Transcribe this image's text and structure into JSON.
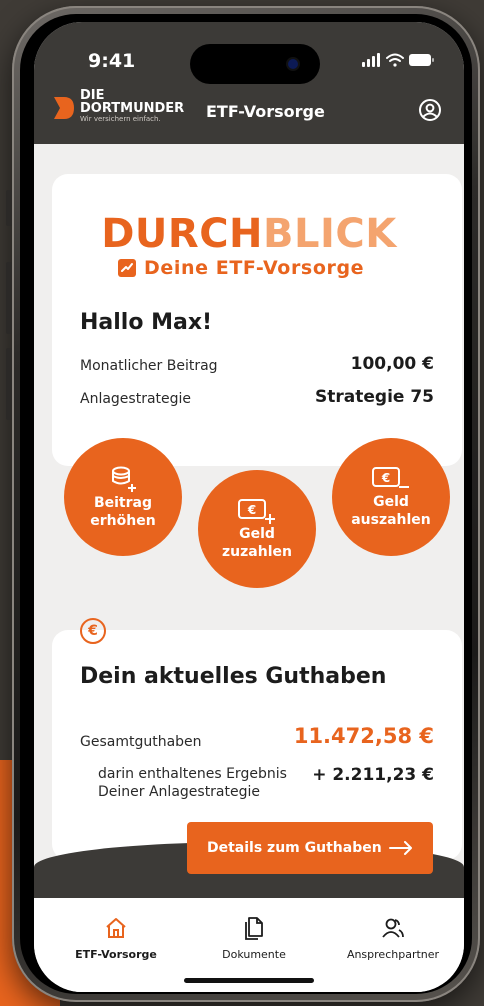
{
  "status": {
    "time": "9:41"
  },
  "header": {
    "logo_line1": "DIE",
    "logo_line2": "DORTMUNDER",
    "logo_tagline": "Wir versichern einfach.",
    "title": "ETF-Vorsorge"
  },
  "brand": {
    "word_dark": "DURCH",
    "word_light": "BLICK",
    "tagline": "Deine ETF-Vorsorge"
  },
  "summary": {
    "greeting": "Hallo Max!",
    "rows": [
      {
        "label": "Monatlicher Beitrag",
        "value": "100,00 €"
      },
      {
        "label": "Anlagestrategie",
        "value": "Strategie 75"
      }
    ]
  },
  "actions": [
    {
      "label": "Beitrag\nerhöhen",
      "icon": "coins-plus-icon"
    },
    {
      "label": "Geld\nzuzahlen",
      "icon": "wallet-plus-icon"
    },
    {
      "label": "Geld\nauszahlen",
      "icon": "wallet-minus-icon"
    }
  ],
  "balance": {
    "badge": "€",
    "title": "Dein aktuelles Guthaben",
    "total_label": "Gesamtguthaben",
    "total_value": "11.472,58 €",
    "result_label": "darin enthaltenes Ergebnis\nDeiner Anlagestrategie",
    "result_value": "+ 2.211,23 €",
    "details_button": "Details zum Guthaben"
  },
  "tabs": [
    {
      "label": "ETF-Vorsorge",
      "icon": "home-icon",
      "active": true
    },
    {
      "label": "Dokumente",
      "icon": "documents-icon",
      "active": false
    },
    {
      "label": "Ansprechpartner",
      "icon": "contact-icon",
      "active": false
    }
  ],
  "colors": {
    "accent": "#e8641e",
    "accent_light": "#f4a46f",
    "header_bg": "#3c3a37",
    "screen_bg": "#f0efee"
  }
}
